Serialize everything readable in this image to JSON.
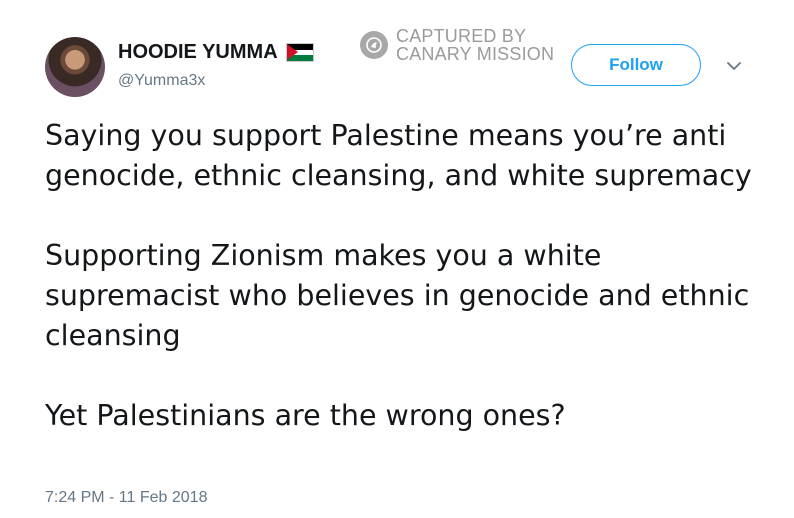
{
  "user": {
    "display_name": "HOODIE YUMMA",
    "handle": "@Yumma3x",
    "flag_icon": "palestine-flag-icon"
  },
  "watermark": {
    "line1": "CAPTURED BY",
    "line2": "CANARY MISSION",
    "icon": "canary-mission-icon"
  },
  "actions": {
    "follow_label": "Follow",
    "caret_icon": "chevron-down-icon"
  },
  "tweet": {
    "paragraphs": [
      "Saying you support Palestine means you’re anti genocide, ethnic cleansing, and white supremacy",
      "Supporting Zionism makes you a white supremacist who believes in genocide and ethnic cleansing",
      "Yet Palestinians are the wrong ones?"
    ],
    "timestamp": "7:24 PM - 11 Feb 2018"
  },
  "colors": {
    "accent": "#1da1f2",
    "secondary_text": "#657786",
    "primary_text": "#14171a"
  }
}
